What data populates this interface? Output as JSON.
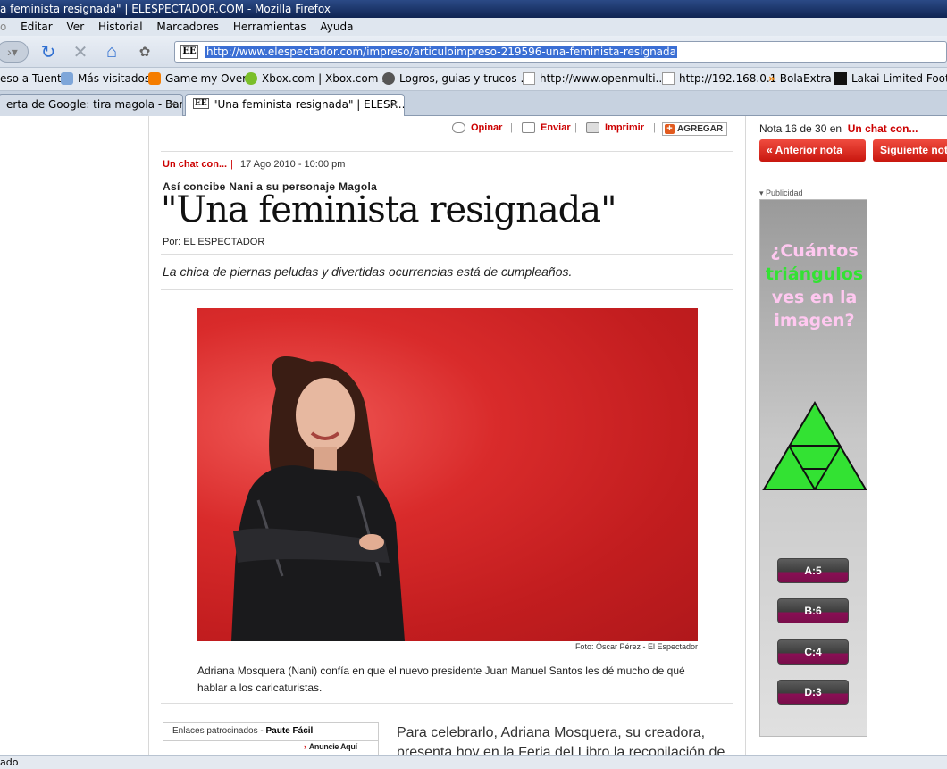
{
  "window": {
    "title": "a feminista resignada\" | ELESPECTADOR.COM - Mozilla Firefox"
  },
  "menu": [
    "Editar",
    "Ver",
    "Historial",
    "Marcadores",
    "Herramientas",
    "Ayuda"
  ],
  "address_bar": {
    "url": "http://www.elespectador.com/impreso/articuloimpreso-219596-una-feminista-resignada",
    "favicon": "EE"
  },
  "bookmarks": [
    {
      "label": "eso a Tuenti",
      "icon": "none"
    },
    {
      "label": "Más visitados",
      "icon": "search-icon"
    },
    {
      "label": "Game my Over",
      "icon": "blogger-icon"
    },
    {
      "label": "Xbox.com | Xbox.com ...",
      "icon": "xbox-icon"
    },
    {
      "label": "Logros, guias y trucos ...",
      "icon": "globe-icon"
    },
    {
      "label": "http://www.openmulti...",
      "icon": "page-icon"
    },
    {
      "label": "http://192.168.0.1",
      "icon": "page-icon"
    },
    {
      "label": "BolaExtra",
      "icon": "rss-icon"
    },
    {
      "label": "Lakai Limited Footw",
      "icon": "lakai-icon"
    }
  ],
  "tabs": [
    {
      "label": "erta de Google: tira magola - Ban...",
      "active": false
    },
    {
      "label": "\"Una feminista resignada\" | ELESP...",
      "active": true
    }
  ],
  "article_tools": {
    "opinar": "Opinar",
    "enviar": "Enviar",
    "imprimir": "Imprimir",
    "agregar": "AGREGAR"
  },
  "article": {
    "section": "Un chat con...",
    "date": "17 Ago 2010 - 10:00 pm",
    "kicker": "Así concibe Nani a su personaje Magola",
    "headline": "\"Una feminista resignada\"",
    "byline": "Por: EL ESPECTADOR",
    "lead": "La chica de piernas peludas y divertidas ocurrencias está de cumpleaños.",
    "photo_credit": "Foto: Óscar Pérez - El Espectador",
    "caption": "Adriana Mosquera (Nani) confía en que el nuevo presidente Juan Manuel Santos les dé mucho de qué hablar a los caricaturistas.",
    "body_start": "Para celebrarlo, Adriana Mosquera, su creadora, presenta hoy en la Feria del Libro la recopilación de"
  },
  "sponsored": {
    "title_prefix": "Enlaces patrocinados - ",
    "title_bold": "Paute Fácil",
    "anuncio": "Anuncie Aquí"
  },
  "sidebar": {
    "nota_prefix": "Nota 16 de 30 en",
    "nota_section": "Un chat con...",
    "prev_label": "« Anterior nota",
    "next_label": "Siguiente nota",
    "publicidad": "▾ Publicidad"
  },
  "ad": {
    "question_lines": [
      "¿Cuántos",
      "triángulos",
      "ves en la",
      "imagen?"
    ],
    "options": [
      "A:5",
      "B:6",
      "C:4",
      "D:3"
    ],
    "colors": {
      "pink": "#ffc8f0",
      "green": "#33e233"
    }
  },
  "status": "ado",
  "colors": {
    "brand_red": "#cc0000"
  }
}
